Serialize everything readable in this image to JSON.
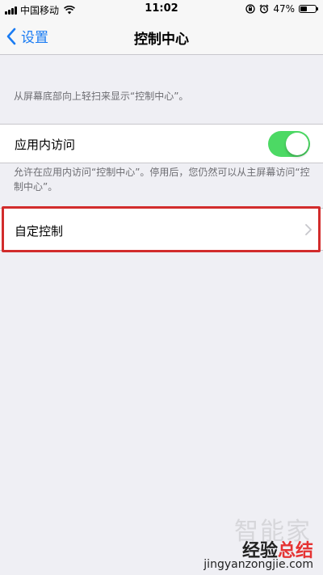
{
  "status_bar": {
    "carrier": "中国移动",
    "time": "11:02",
    "battery_percent": "47%",
    "battery_level": 0.47,
    "icons": [
      "signal-icon",
      "wifi-icon",
      "orientation-lock-icon",
      "alarm-icon",
      "battery-icon"
    ]
  },
  "nav": {
    "back_label": "设置",
    "title": "控制中心"
  },
  "section_header": "从屏幕底部向上轻扫来显示“控制中心”。",
  "access_in_apps": {
    "label": "应用内访问",
    "enabled": true,
    "footer": "允许在应用内访问“控制中心”。停用后，您仍然可以从主屏幕访问“控制中心”。"
  },
  "customize": {
    "label": "自定控制"
  },
  "colors": {
    "accent_blue": "#1a7cf3",
    "toggle_green": "#4cd964",
    "highlight_red": "#d22c2c",
    "background": "#efeff4"
  },
  "watermark": {
    "logo": "智能家",
    "text_prefix": "经验",
    "text_accent": "总结",
    "url": "jingyanzongjie.com"
  }
}
